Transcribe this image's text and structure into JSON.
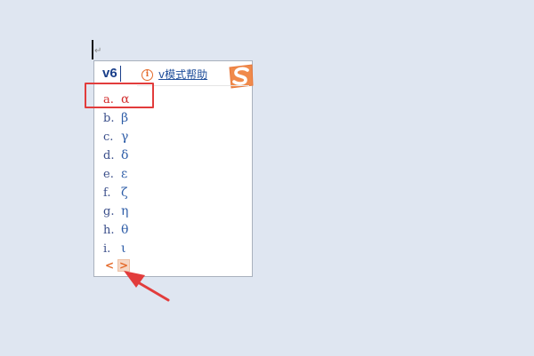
{
  "ime": {
    "input_text": "v6",
    "help_label": "v模式帮助",
    "info_icon": "info-circle-icon",
    "logo_icon": "sogou-s-logo-icon",
    "brand_color": "#f08a4b",
    "highlight_color": "#e23c3c"
  },
  "document": {
    "paragraph_mark": "↵"
  },
  "candidates": [
    {
      "key": "a.",
      "char": "α",
      "selected": true
    },
    {
      "key": "b.",
      "char": "β",
      "selected": false
    },
    {
      "key": "c.",
      "char": "γ",
      "selected": false
    },
    {
      "key": "d.",
      "char": "δ",
      "selected": false
    },
    {
      "key": "e.",
      "char": "ε",
      "selected": false
    },
    {
      "key": "f.",
      "char": "ζ",
      "selected": false
    },
    {
      "key": "g.",
      "char": "η",
      "selected": false
    },
    {
      "key": "h.",
      "char": "θ",
      "selected": false
    },
    {
      "key": "i.",
      "char": "ι",
      "selected": false
    }
  ],
  "pager": {
    "prev_label": "<",
    "next_label": ">"
  }
}
